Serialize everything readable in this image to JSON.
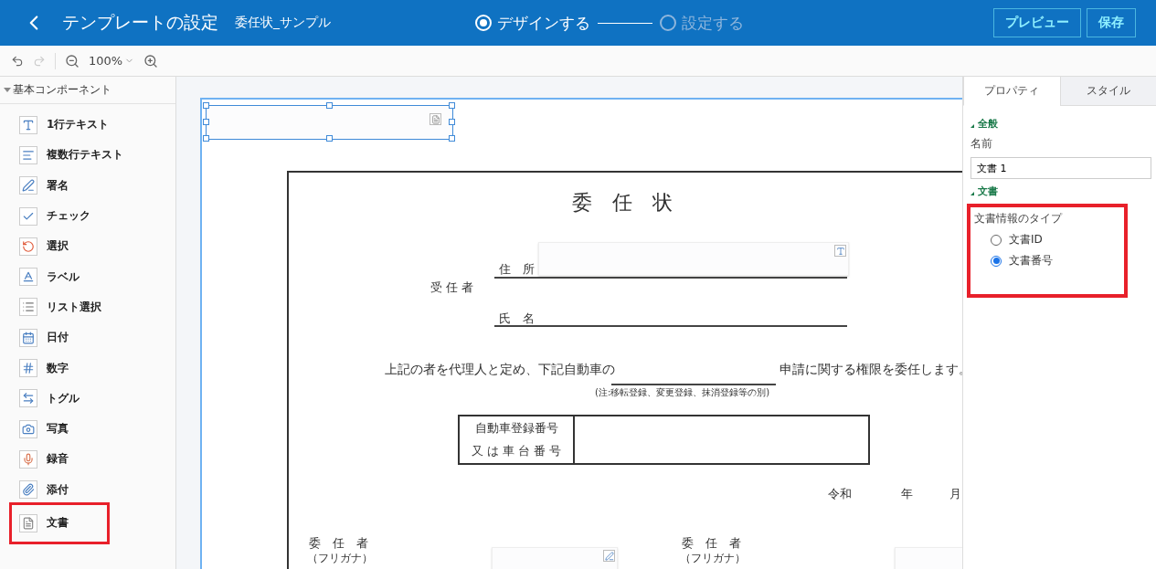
{
  "header": {
    "title": "テンプレートの設定",
    "document_name": "委任状_サンプル",
    "steps": [
      {
        "label": "デザインする",
        "selected": true
      },
      {
        "label": "設定する",
        "selected": false
      }
    ],
    "buttons": [
      "プレビュー",
      "保存"
    ]
  },
  "toolbar": {
    "undo": {
      "disabled": false
    },
    "redo": {
      "disabled": true
    },
    "zoom": "100%"
  },
  "sidebar": {
    "heading": "基本コンポーネント",
    "expanded": true,
    "items": [
      {
        "label": "1行テキスト",
        "kind": "text",
        "highlighted": false
      },
      {
        "label": "複数行テキスト",
        "kind": "multiline",
        "highlighted": false
      },
      {
        "label": "署名",
        "kind": "signature",
        "highlighted": false
      },
      {
        "label": "チェック",
        "kind": "check",
        "highlighted": false
      },
      {
        "label": "選択",
        "kind": "choice",
        "highlighted": false
      },
      {
        "label": "ラベル",
        "kind": "label",
        "highlighted": false
      },
      {
        "label": "リスト選択",
        "kind": "list",
        "highlighted": false
      },
      {
        "label": "日付",
        "kind": "date",
        "highlighted": false
      },
      {
        "label": "数字",
        "kind": "number",
        "highlighted": false
      },
      {
        "label": "トグル",
        "kind": "toggle",
        "highlighted": false
      },
      {
        "label": "写真",
        "kind": "photo",
        "highlighted": false
      },
      {
        "label": "録音",
        "kind": "audio",
        "highlighted": false
      },
      {
        "label": "添付",
        "kind": "attachment",
        "highlighted": false
      },
      {
        "label": "文書",
        "kind": "document",
        "highlighted": true
      }
    ]
  },
  "document": {
    "title": "委　任　状",
    "agent_label": "受 任 者",
    "address_label": "住　所",
    "name_label": "氏　名",
    "sentence_start": "上記の者を代理人と定め、下記自動車の",
    "sentence_end": "申請に関する権限を委任します。",
    "note": "(注:移転登録、変更登録、抹消登録等の別)",
    "table_labels": [
      "自動車登録番号",
      "又 は 車 台 番 号"
    ],
    "date": [
      "令和",
      "年",
      "月"
    ],
    "principals": [
      {
        "label": "委　任　者",
        "furigana": "（フリガナ）"
      },
      {
        "label": "委　任　者",
        "furigana": "（フリガナ）"
      }
    ]
  },
  "properties": {
    "tabs": [
      {
        "label": "プロパティ",
        "selected": true
      },
      {
        "label": "スタイル",
        "selected": false
      }
    ],
    "general": {
      "heading": "全般",
      "expanded": true,
      "name_label": "名前",
      "name_value": "文書 1"
    },
    "document_section": {
      "heading": "文書",
      "expanded": true,
      "type_label": "文書情報のタイプ",
      "highlighted": true,
      "options": [
        {
          "label": "文書ID",
          "selected": false
        },
        {
          "label": "文書番号",
          "selected": true
        }
      ]
    }
  }
}
